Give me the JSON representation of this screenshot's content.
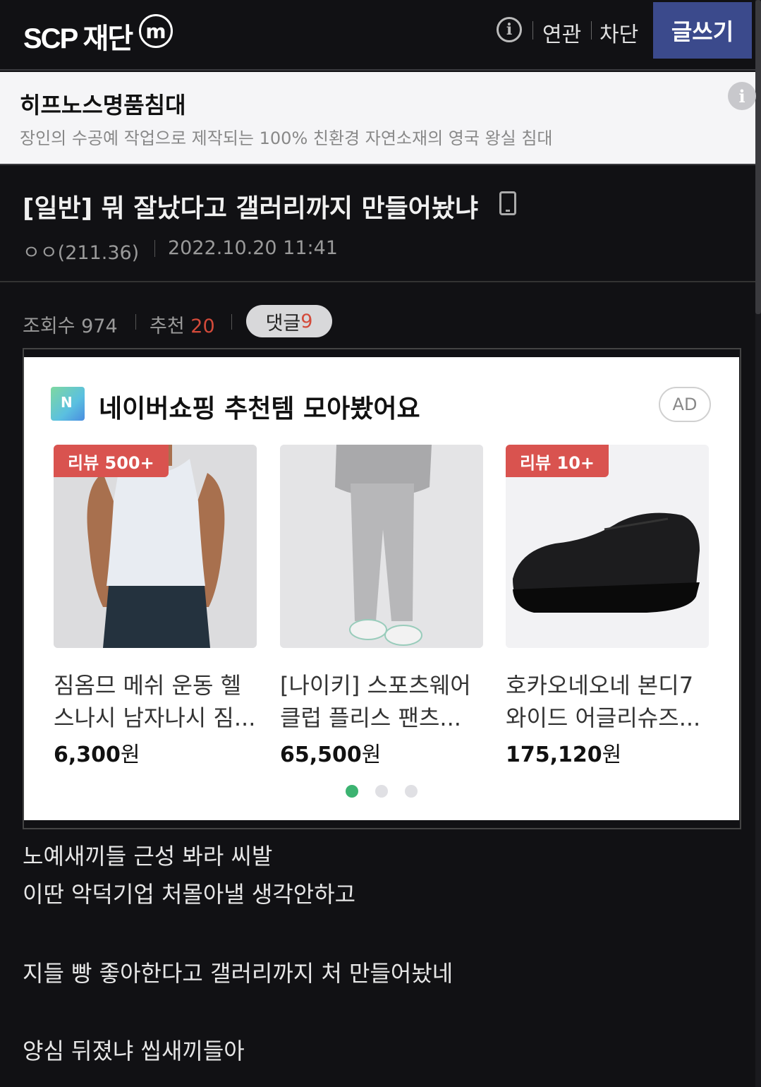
{
  "header": {
    "logo": "SCP 재단",
    "m_icon": "m",
    "info_icon": "i",
    "related": "연관",
    "block": "차단",
    "write": "글쓰기"
  },
  "top_ad": {
    "title": "히프노스명품침대",
    "desc": "장인의 수공예 작업으로 제작되는 100% 친환경 자연소재의 영국 왕실 침대",
    "info_icon": "i"
  },
  "post": {
    "title": "[일반] 뭐 잘났다고 갤러리까지 만들어놨냐",
    "author": "ㅇㅇ(211.36)",
    "date": "2022.10.20 11:41",
    "views_label": "조회수",
    "views": "974",
    "recommend_label": "추천",
    "recommend": "20",
    "comments_label": "댓글",
    "comments": "9"
  },
  "shopping_ad": {
    "title": "네이버쇼핑 추천템 모아봤어요",
    "ad_badge": "AD",
    "products": [
      {
        "tag": "리뷰 500+",
        "name": "짐옴므 메쉬 운동 헬스나시 남자나시 짐...",
        "price": "6,300",
        "unit": "원"
      },
      {
        "tag": "",
        "name": "[나이키] 스포츠웨어 클럽 플리스 팬츠...",
        "price": "65,500",
        "unit": "원"
      },
      {
        "tag": "리뷰 10+",
        "name": "호카오네오네 본디7 와이드 어글리슈즈...",
        "price": "175,120",
        "unit": "원"
      }
    ],
    "page_count": 3,
    "active_page": 1
  },
  "body": {
    "lines": [
      "노예새끼들 근성 봐라 씨발",
      "이딴 악덕기업 처몰아낼 생각안하고",
      "지들 빵 좋아한다고 갤러리까지 처 만들어놨네",
      "양심 뒤졌냐 씹새끼들아"
    ]
  },
  "colors": {
    "background": "#111114",
    "write_button": "#3b4a8c",
    "review_tag": "#d9534f",
    "recommend_count": "#d34a3a",
    "active_dot": "#3cb371"
  }
}
